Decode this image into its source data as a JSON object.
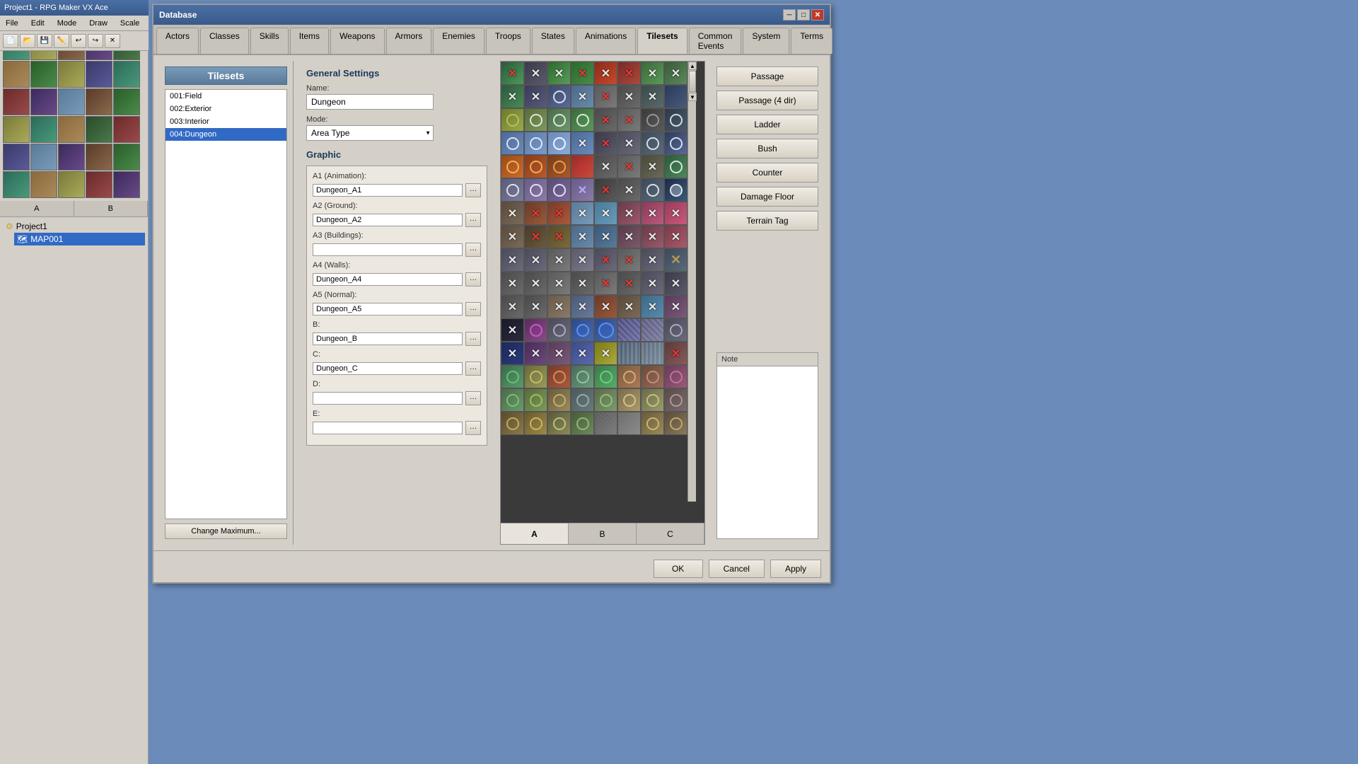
{
  "app": {
    "title": "Project1 - RPG Maker VX Ace",
    "menu_items": [
      "File",
      "Edit",
      "Mode",
      "Draw",
      "Scale"
    ],
    "left_panel_title": "Project1",
    "map_item": "MAP001"
  },
  "dialog": {
    "title": "Database",
    "tabs": [
      "Actors",
      "Classes",
      "Skills",
      "Items",
      "Weapons",
      "Armors",
      "Enemies",
      "Troops",
      "States",
      "Animations",
      "Tilesets",
      "Common Events",
      "System",
      "Terms"
    ],
    "active_tab": "Tilesets",
    "list": {
      "header": "Tilesets",
      "items": [
        "001:Field",
        "002:Exterior",
        "003:Interior",
        "004:Dungeon"
      ],
      "selected": 3,
      "change_btn": "Change Maximum..."
    },
    "settings": {
      "section": "General Settings",
      "name_label": "Name:",
      "name_value": "Dungeon",
      "mode_label": "Mode:",
      "mode_value": "Area Type",
      "graphic_section": "Graphic",
      "a1_label": "A1 (Animation):",
      "a1_value": "Dungeon_A1",
      "a2_label": "A2 (Ground):",
      "a2_value": "Dungeon_A2",
      "a3_label": "A3 (Buildings):",
      "a3_value": "",
      "a4_label": "A4 (Walls):",
      "a4_value": "Dungeon_A4",
      "a5_label": "A5 (Normal):",
      "a5_value": "Dungeon_A5",
      "b_label": "B:",
      "b_value": "Dungeon_B",
      "c_label": "C:",
      "c_value": "Dungeon_C",
      "d_label": "D:",
      "d_value": "",
      "e_label": "E:",
      "e_value": ""
    },
    "passage_btns": [
      "Passage",
      "Passage (4 dir)",
      "Ladder",
      "Bush",
      "Counter",
      "Damage Floor",
      "Terrain Tag"
    ],
    "note_label": "Note",
    "tileset_tabs": [
      "A",
      "B",
      "C"
    ],
    "active_tileset_tab": "A",
    "footer": {
      "ok": "OK",
      "cancel": "Cancel",
      "apply": "Apply"
    }
  },
  "left_tabs": [
    "A",
    "B"
  ],
  "icons": {
    "close": "✕",
    "minimize": "─",
    "maximize": "□",
    "dots": "···",
    "arrow_down": "▼",
    "arrow_up": "▲",
    "folder": "📁",
    "map": "🗺"
  }
}
